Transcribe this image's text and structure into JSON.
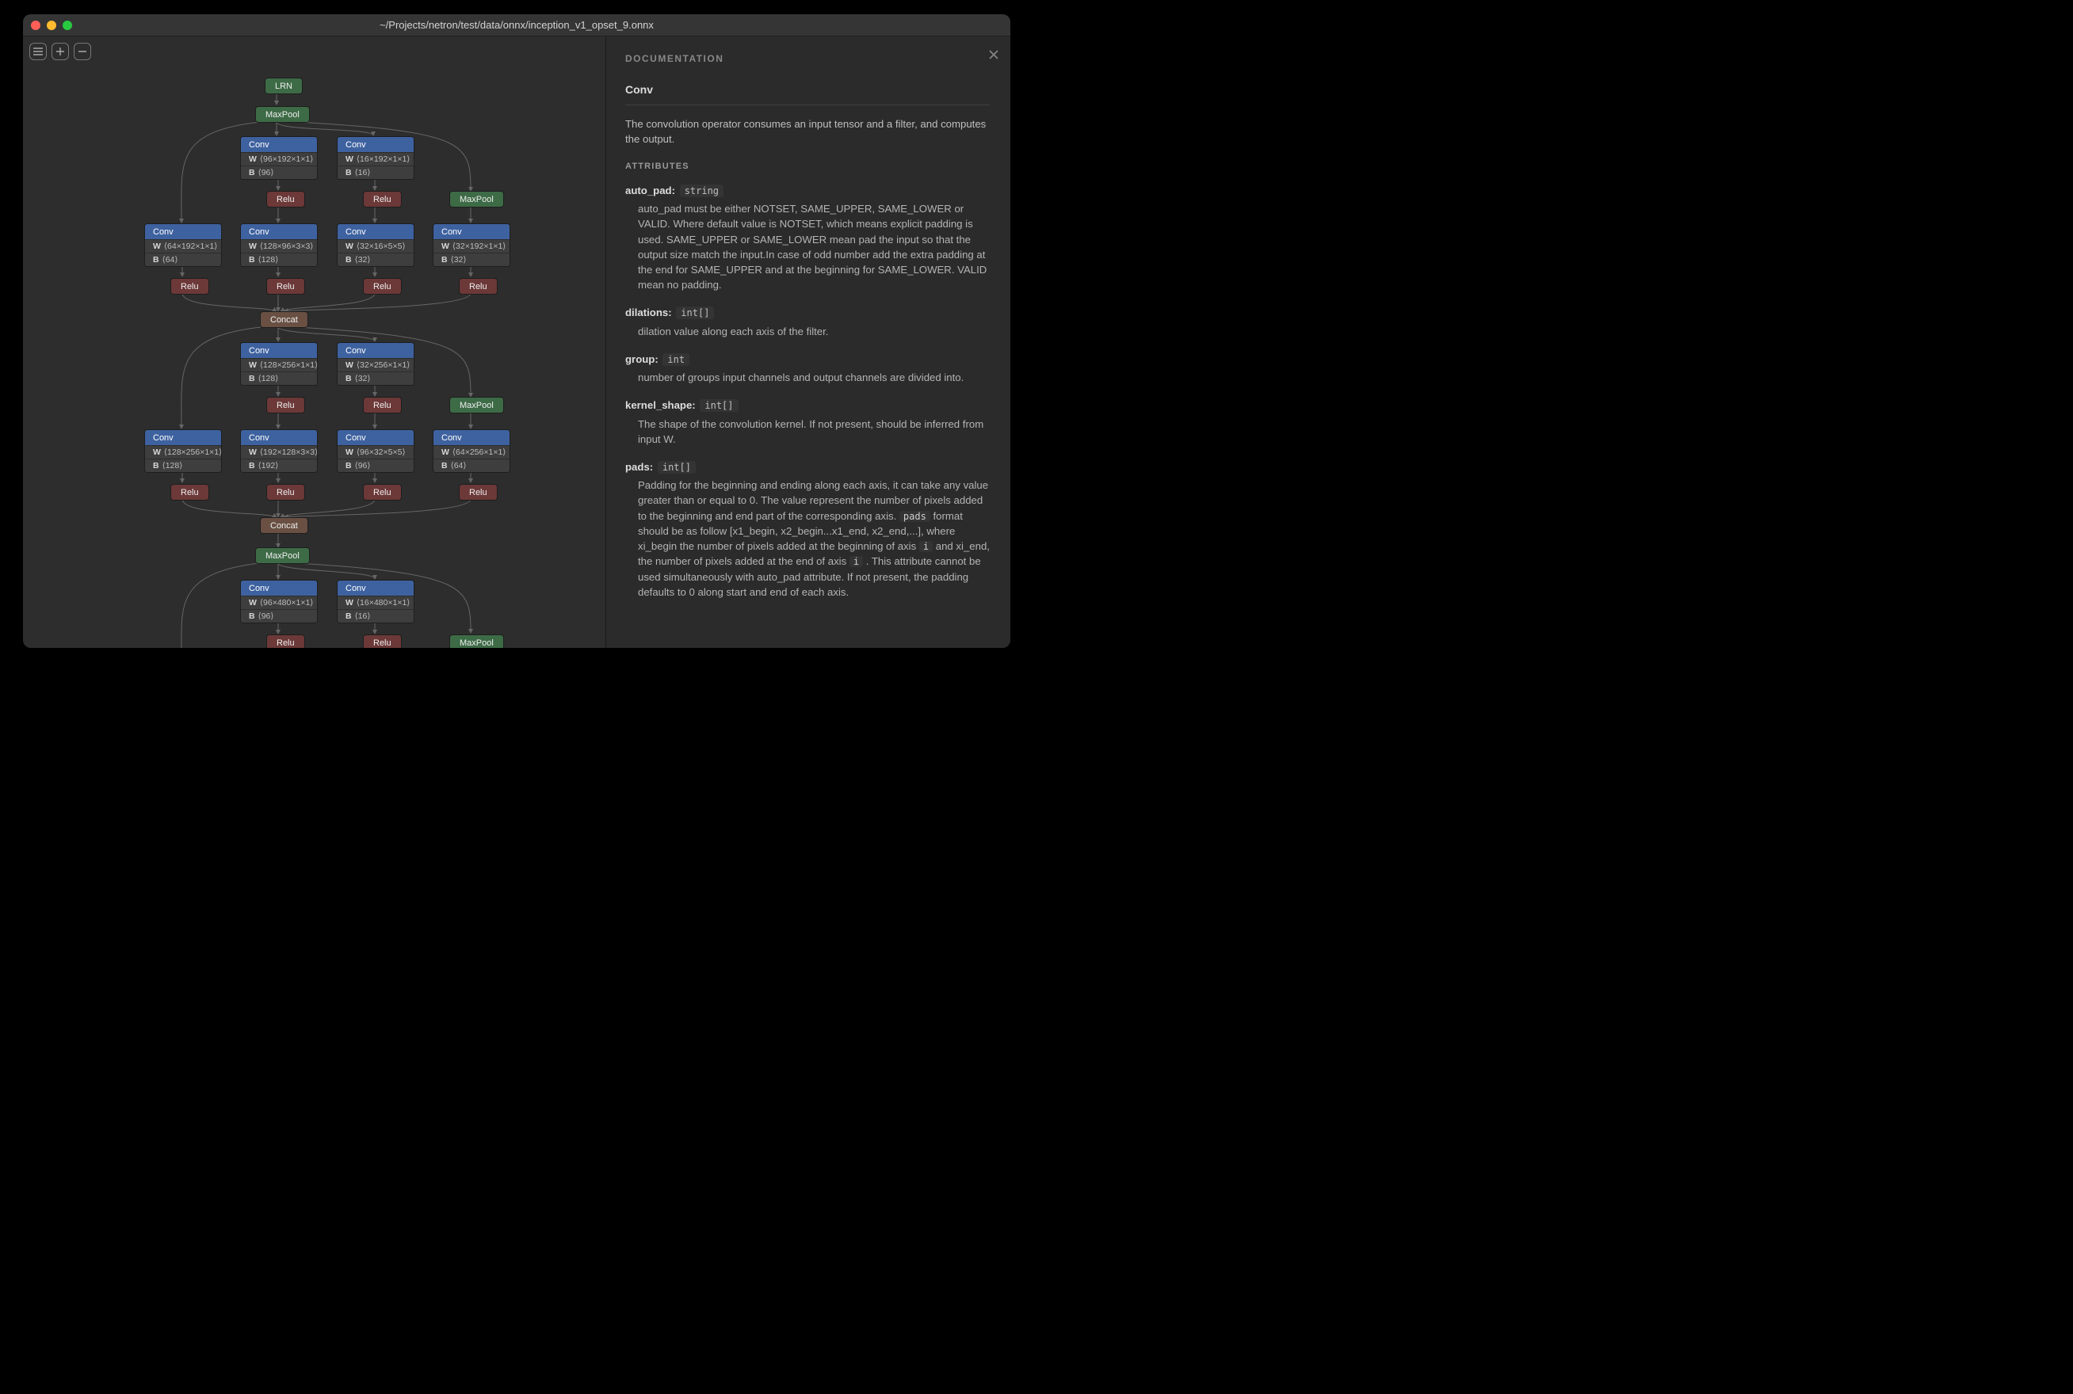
{
  "window": {
    "title": "~/Projects/netron/test/data/onnx/inception_v1_opset_9.onnx"
  },
  "toolbar": {
    "menu_tooltip": "Menu",
    "zoom_in_tooltip": "Zoom In",
    "zoom_out_tooltip": "Zoom Out"
  },
  "nodes": {
    "lrn": "LRN",
    "maxpool": "MaxPool",
    "conv": "Conv",
    "relu": "Relu",
    "concat": "Concat"
  },
  "shapes": {
    "w_label": "W",
    "b_label": "B",
    "c1_w": "⟨96×192×1×1⟩",
    "c1_b": "⟨96⟩",
    "c2_w": "⟨16×192×1×1⟩",
    "c2_b": "⟨16⟩",
    "c3_w": "⟨64×192×1×1⟩",
    "c3_b": "⟨64⟩",
    "c4_w": "⟨128×96×3×3⟩",
    "c4_b": "⟨128⟩",
    "c5_w": "⟨32×16×5×5⟩",
    "c5_b": "⟨32⟩",
    "c6_w": "⟨32×192×1×1⟩",
    "c6_b": "⟨32⟩",
    "c7_w": "⟨128×256×1×1⟩",
    "c7_b": "⟨128⟩",
    "c8_w": "⟨32×256×1×1⟩",
    "c8_b": "⟨32⟩",
    "c9_w": "⟨128×256×1×1⟩",
    "c9_b": "⟨128⟩",
    "c10_w": "⟨192×128×3×3⟩",
    "c10_b": "⟨192⟩",
    "c11_w": "⟨96×32×5×5⟩",
    "c11_b": "⟨96⟩",
    "c12_w": "⟨64×256×1×1⟩",
    "c12_b": "⟨64⟩",
    "c13_w": "⟨96×480×1×1⟩",
    "c13_b": "⟨96⟩",
    "c14_w": "⟨16×480×1×1⟩",
    "c14_b": "⟨16⟩"
  },
  "doc": {
    "header": "DOCUMENTATION",
    "name": "Conv",
    "description": "The convolution operator consumes an input tensor and a filter, and computes the output.",
    "attributes_header": "ATTRIBUTES",
    "attrs": {
      "auto_pad": {
        "name": "auto_pad:",
        "type": "string",
        "body": "auto_pad must be either NOTSET, SAME_UPPER, SAME_LOWER or VALID. Where default value is NOTSET, which means explicit padding is used. SAME_UPPER or SAME_LOWER mean pad the input so that the output size match the input.In case of odd number add the extra padding at the end for SAME_UPPER and at the beginning for SAME_LOWER. VALID mean no padding."
      },
      "dilations": {
        "name": "dilations:",
        "type": "int[]",
        "body": "dilation value along each axis of the filter."
      },
      "group": {
        "name": "group:",
        "type": "int",
        "body": "number of groups input channels and output channels are divided into."
      },
      "kernel_shape": {
        "name": "kernel_shape:",
        "type": "int[]",
        "body": "The shape of the convolution kernel. If not present, should be inferred from input W."
      },
      "pads": {
        "name": "pads:",
        "type": "int[]",
        "body_pre": "Padding for the beginning and ending along each axis, it can take any value greater than or equal to 0. The value represent the number of pixels added to the beginning and end part of the corresponding axis. ",
        "code_pads": "pads",
        "body_mid1": " format should be as follow [x1_begin, x2_begin...x1_end, x2_end,...], where xi_begin the number of pixels added at the beginning of axis ",
        "code_i1": "i",
        "body_mid2": " and xi_end, the number of pixels added at the end of axis ",
        "code_i2": "i",
        "body_post": ". This attribute cannot be used simultaneously with auto_pad attribute. If not present, the padding defaults to 0 along start and end of each axis."
      }
    }
  }
}
